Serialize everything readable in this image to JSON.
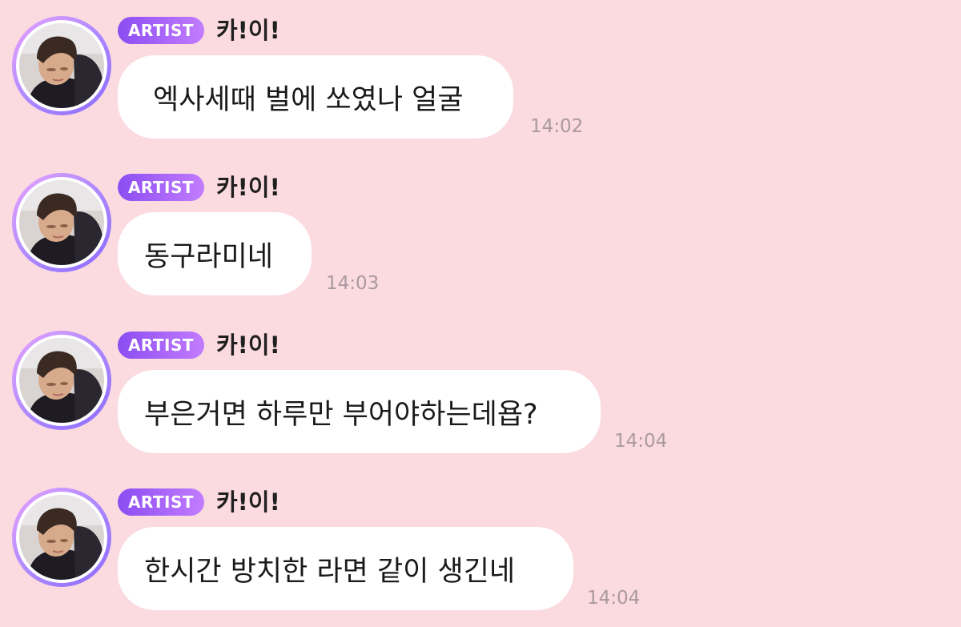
{
  "chat": {
    "messages": [
      {
        "badge": "ARTIST",
        "sender": "카!이!",
        "text": "엑사세때 벌에 쏘였나 얼굴",
        "time": "14:02"
      },
      {
        "badge": "ARTIST",
        "sender": "카!이!",
        "text": "동구라미네",
        "time": "14:03"
      },
      {
        "badge": "ARTIST",
        "sender": "카!이!",
        "text": "부은거면 하루만 부어야하는데욥?",
        "time": "14:04"
      },
      {
        "badge": "ARTIST",
        "sender": "카!이!",
        "text": "한시간 방치한 라면 같이 생긴네",
        "time": "14:04"
      }
    ]
  },
  "colors": {
    "background": "#fbdae0",
    "bubble": "#ffffff",
    "badge_start": "#8c4df2",
    "badge_end": "#c27cff",
    "timestamp": "#a99aa0"
  },
  "icons": {
    "avatar": "profile-photo-avatar"
  }
}
